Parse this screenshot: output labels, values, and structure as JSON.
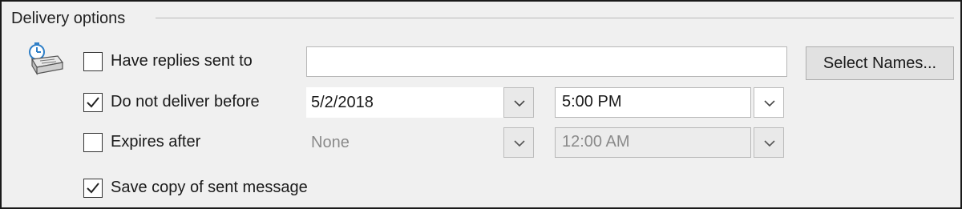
{
  "group": {
    "title": "Delivery options"
  },
  "icon": "delivery-clock-icon",
  "replies": {
    "label": "Have replies sent to",
    "checked": false,
    "value": ""
  },
  "select_names": {
    "label": "Select Names..."
  },
  "do_not_deliver": {
    "label": "Do not deliver before",
    "checked": true,
    "date": "5/2/2018",
    "time": "5:00 PM"
  },
  "expires": {
    "label": "Expires after",
    "checked": false,
    "date": "None",
    "time": "12:00 AM"
  },
  "save_copy": {
    "label": "Save copy of sent message",
    "checked": true
  }
}
